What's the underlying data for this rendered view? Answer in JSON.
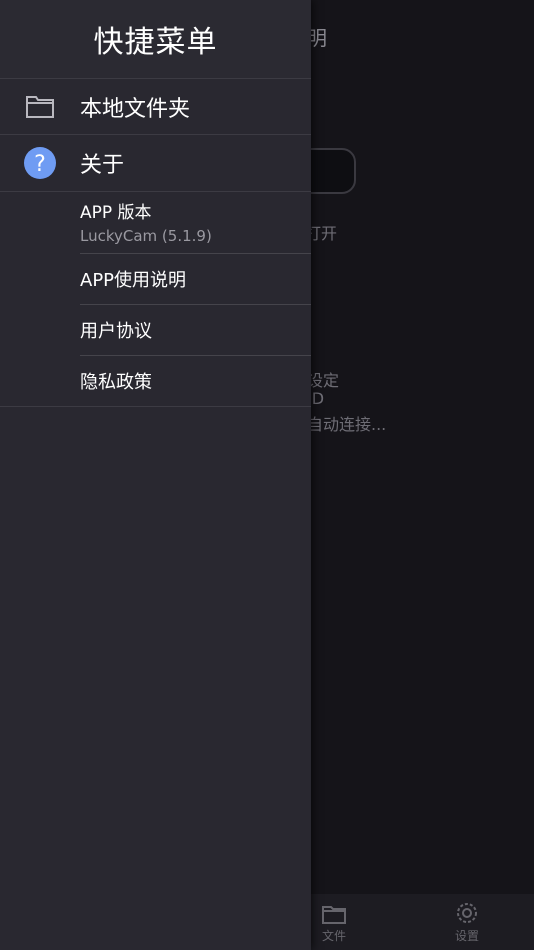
{
  "background": {
    "title_fragment": "明",
    "open_fragment": "打开",
    "lines": [
      "设定",
      "ID",
      "自动连接..."
    ],
    "tabs": [
      {
        "label": "文件",
        "icon": "folder-icon"
      },
      {
        "label": "设置",
        "icon": "gear-icon"
      }
    ]
  },
  "drawer": {
    "title": "快捷菜单",
    "items": [
      {
        "label": "本地文件夹",
        "icon": "folder-icon"
      },
      {
        "label": "关于",
        "icon": "question-circle-icon"
      }
    ],
    "about": {
      "version_label": "APP 版本",
      "version_value": "LuckyCam (5.1.9)",
      "links": [
        "APP使用说明",
        "用户协议",
        "隐私政策"
      ]
    }
  },
  "colors": {
    "drawer_bg": "#292830",
    "help_icon": "#6f9cf3"
  }
}
